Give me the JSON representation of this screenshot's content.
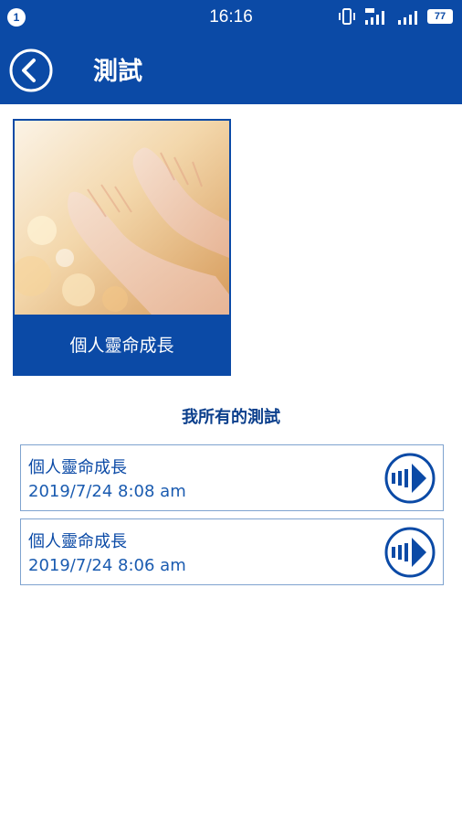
{
  "status": {
    "notification_count": "1",
    "time": "16:16",
    "battery": "77"
  },
  "appbar": {
    "title": "測試"
  },
  "card": {
    "label": "個人靈命成長"
  },
  "section_title": "我所有的測試",
  "results": [
    {
      "name": "個人靈命成長",
      "date": "2019/7/24 8:08 am"
    },
    {
      "name": "個人靈命成長",
      "date": "2019/7/24 8:06 am"
    }
  ],
  "colors": {
    "brand": "#0b4aa6",
    "border": "#7fa3cf"
  },
  "icons": {
    "back": "back-arrow-icon",
    "play": "play-arrow-icon"
  }
}
